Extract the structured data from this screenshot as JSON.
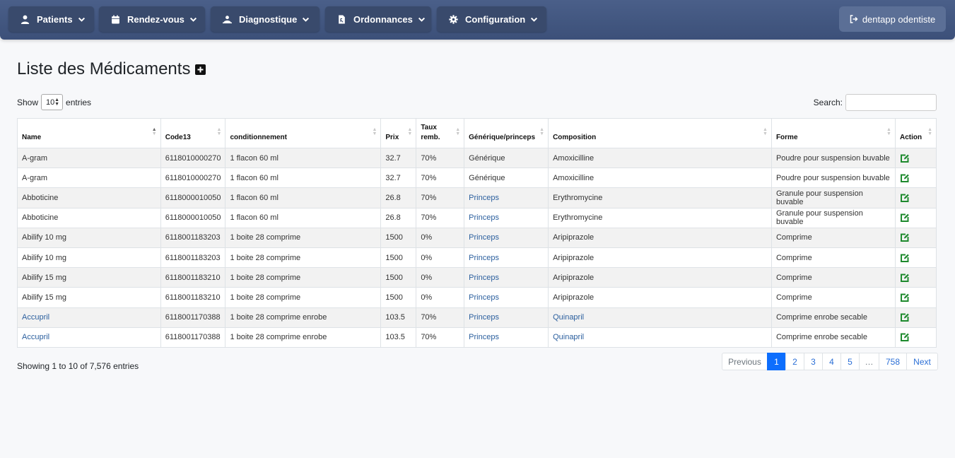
{
  "nav": {
    "patients": "Patients",
    "rendezvous": "Rendez-vous",
    "diagnostique": "Diagnostique",
    "ordonnances": "Ordonnances",
    "configuration": "Configuration",
    "user": "dentapp odentiste"
  },
  "page": {
    "title": "Liste des Médicaments"
  },
  "controls": {
    "show_label": "Show",
    "length_value": "10",
    "entries_label": "entries",
    "search_label": "Search:"
  },
  "table": {
    "headers": {
      "name": "Name",
      "code13": "Code13",
      "conditionnement": "conditionnement",
      "prix": "Prix",
      "taux_line1": "Taux",
      "taux_line2": "remb.",
      "generique": "Générique/princeps",
      "composition": "Composition",
      "forme": "Forme",
      "action": "Action"
    },
    "rows": [
      {
        "name": "A-gram",
        "code": "6118010000270",
        "cond": "1 flacon 60 ml",
        "prix": "32.7",
        "taux": "70%",
        "gen": "Générique",
        "comp": "Amoxicilline",
        "forme": "Poudre pour suspension buvable"
      },
      {
        "name": "A-gram",
        "code": "6118010000270",
        "cond": "1 flacon 60 ml",
        "prix": "32.7",
        "taux": "70%",
        "gen": "Générique",
        "comp": "Amoxicilline",
        "forme": "Poudre pour suspension buvable"
      },
      {
        "name": "Abboticine",
        "code": "6118000010050",
        "cond": "1 flacon 60 ml",
        "prix": "26.8",
        "taux": "70%",
        "gen": "Princeps",
        "comp": "Erythromycine",
        "forme": "Granule pour suspension buvable"
      },
      {
        "name": "Abboticine",
        "code": "6118000010050",
        "cond": "1 flacon 60 ml",
        "prix": "26.8",
        "taux": "70%",
        "gen": "Princeps",
        "comp": "Erythromycine",
        "forme": "Granule pour suspension buvable"
      },
      {
        "name": "Abilify 10 mg",
        "code": "6118001183203",
        "cond": "1 boite 28 comprime",
        "prix": "1500",
        "taux": "0%",
        "gen": "Princeps",
        "comp": "Aripiprazole",
        "forme": "Comprime"
      },
      {
        "name": "Abilify 10 mg",
        "code": "6118001183203",
        "cond": "1 boite 28 comprime",
        "prix": "1500",
        "taux": "0%",
        "gen": "Princeps",
        "comp": "Aripiprazole",
        "forme": "Comprime"
      },
      {
        "name": "Abilify 15 mg",
        "code": "6118001183210",
        "cond": "1 boite 28 comprime",
        "prix": "1500",
        "taux": "0%",
        "gen": "Princeps",
        "comp": "Aripiprazole",
        "forme": "Comprime"
      },
      {
        "name": "Abilify 15 mg",
        "code": "6118001183210",
        "cond": "1 boite 28 comprime",
        "prix": "1500",
        "taux": "0%",
        "gen": "Princeps",
        "comp": "Aripiprazole",
        "forme": "Comprime"
      },
      {
        "name": "Accupril",
        "code": "6118001170388",
        "cond": "1 boite 28 comprime enrobe",
        "prix": "103.5",
        "taux": "70%",
        "gen": "Princeps",
        "comp": "Quinapril",
        "forme": "Comprime enrobe secable"
      },
      {
        "name": "Accupril",
        "code": "6118001170388",
        "cond": "1 boite 28 comprime enrobe",
        "prix": "103.5",
        "taux": "70%",
        "gen": "Princeps",
        "comp": "Quinapril",
        "forme": "Comprime enrobe secable"
      }
    ]
  },
  "footer": {
    "info": "Showing 1 to 10 of 7,576 entries",
    "pagination": {
      "previous": "Previous",
      "p1": "1",
      "p2": "2",
      "p3": "3",
      "p4": "4",
      "p5": "5",
      "ellipsis": "…",
      "last": "758",
      "next": "Next"
    }
  },
  "colors": {
    "navbar": "#3c5079",
    "nav_button": "#394a6c",
    "active_page": "#0d6efd",
    "edit_icon": "#1e8a2e"
  },
  "icons": {
    "patients": "user-icon",
    "rendezvous": "calendar-icon",
    "diagnostique": "user-injured-icon",
    "ordonnances": "file-prescription-icon",
    "configuration": "gear-icon",
    "user": "sign-out-icon",
    "add": "plus-square-icon",
    "action": "edit-icon"
  }
}
